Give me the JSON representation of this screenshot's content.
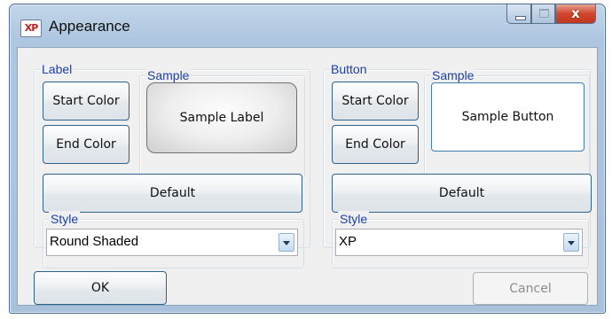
{
  "window": {
    "icon_text": "XP",
    "title": "Appearance",
    "close_glyph": "x"
  },
  "label_panel": {
    "group_title": "Label",
    "start_color": "Start Color",
    "end_color": "End Color",
    "sample_group_title": "Sample",
    "sample_text": "Sample Label",
    "default_button": "Default",
    "style_group_title": "Style",
    "style_value": "Round Shaded"
  },
  "button_panel": {
    "group_title": "Button",
    "start_color": "Start Color",
    "end_color": "End Color",
    "sample_group_title": "Sample",
    "sample_text": "Sample Button",
    "default_button": "Default",
    "style_group_title": "Style",
    "style_value": "XP"
  },
  "footer": {
    "ok": "OK",
    "cancel": "Cancel"
  },
  "colors": {
    "accent_border": "#2c628b",
    "groupbox_legend": "#1c3fa8",
    "close_button": "#d0462d",
    "window_frame": "#aec6df"
  }
}
